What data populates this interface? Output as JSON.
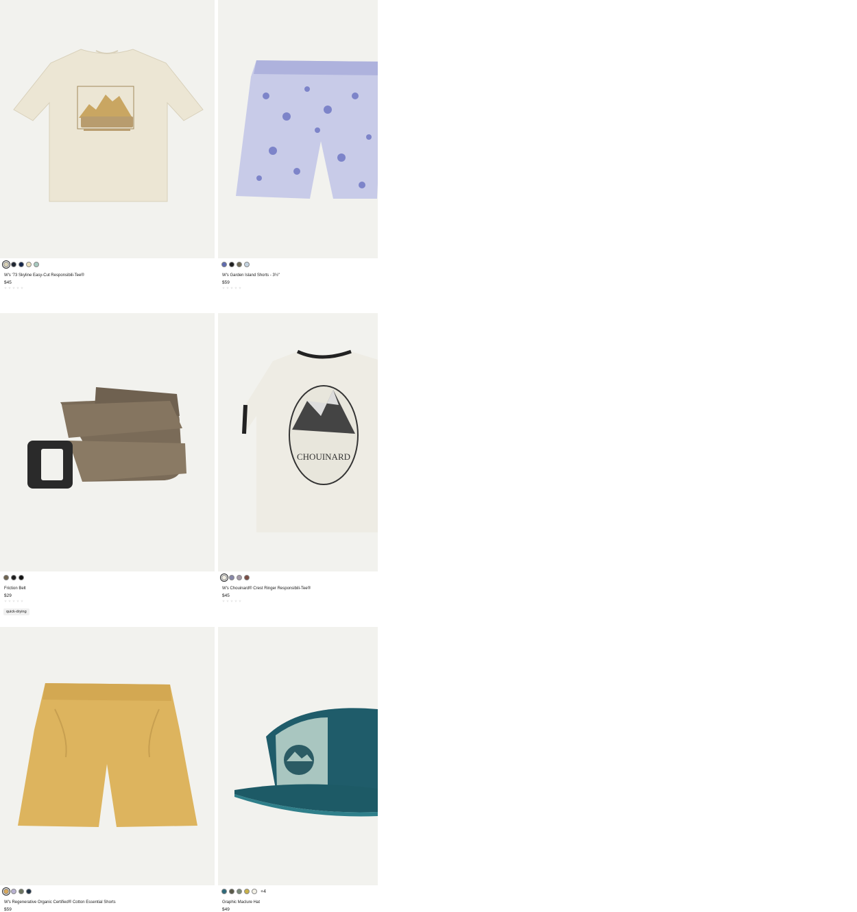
{
  "products": [
    {
      "name": "W's '73 Skyline Easy-Cut Responsibili-Tee®",
      "price": "$45",
      "image": "cream-tee-icon",
      "swatches": [
        "#d9d2b6",
        "#1d2430",
        "#13254a",
        "#ece0bd",
        "#a7c9bf"
      ],
      "selected": 0
    },
    {
      "name": "W's Garden Island Shorts - 3½\"",
      "price": "$59",
      "image": "floral-shorts-icon",
      "swatches": [
        "#5f6bb0",
        "#1e1e1e",
        "#6f6a55",
        "#c4d3e0"
      ],
      "selected": -1
    },
    {
      "name": "Friction Belt",
      "price": "$29",
      "image": "belt-icon",
      "swatches": [
        "#6f6450",
        "#1e1e1e",
        "#111111"
      ],
      "selected": -1,
      "tag": "quick-drying"
    },
    {
      "name": "W's Chouinard® Crest Ringer Responsibili-Tee®",
      "price": "$45",
      "image": "ringer-tee-icon",
      "swatches": [
        "#f0ede2",
        "#8686a8",
        "#a59aa8",
        "#7a4d44"
      ],
      "selected": 0
    },
    {
      "name": "W's Regenerative Organic Certified® Cotton Essential Shorts",
      "price": "$59",
      "image": "yellow-shorts-icon",
      "swatches": [
        "#d9a85a",
        "#b9b2d2",
        "#6b7460",
        "#1f3348"
      ],
      "selected": 0
    },
    {
      "name": "Graphic Maclure Hat",
      "price": "$49",
      "image": "cap-icon",
      "swatches": [
        "#2d6a7a",
        "#5a5a48",
        "#7a8a7a",
        "#c9b24a",
        "#f3f1e6"
      ],
      "selected": -1,
      "more": "+4"
    }
  ],
  "colors": {
    "imageBackground": "#f2f2ee",
    "starEmpty": "#e6e6e6"
  }
}
